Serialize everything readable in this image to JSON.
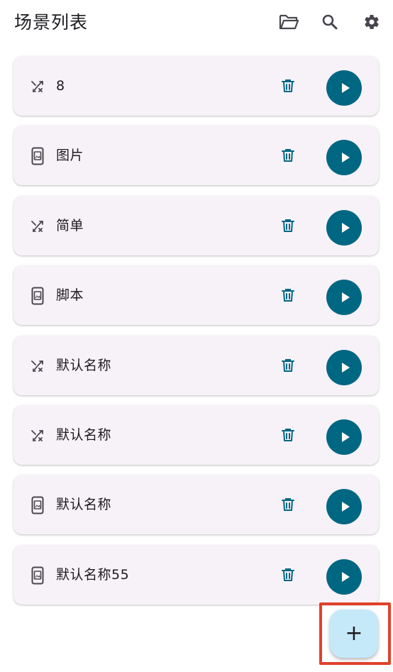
{
  "appbar": {
    "title": "场景列表",
    "actions": [
      {
        "name": "folder-open-icon"
      },
      {
        "name": "search-icon"
      },
      {
        "name": "settings-gear-icon"
      }
    ]
  },
  "scenes": [
    {
      "name": "8",
      "type_icon": "shuffle-cross-icon"
    },
    {
      "name": "图片",
      "type_icon": "phone-screenshot-icon"
    },
    {
      "name": "简单",
      "type_icon": "shuffle-cross-icon"
    },
    {
      "name": "脚本",
      "type_icon": "phone-screenshot-icon"
    },
    {
      "name": "默认名称",
      "type_icon": "shuffle-cross-icon"
    },
    {
      "name": "默认名称",
      "type_icon": "shuffle-cross-icon"
    },
    {
      "name": "默认名称",
      "type_icon": "phone-screenshot-icon"
    },
    {
      "name": "默认名称55",
      "type_icon": "phone-screenshot-icon"
    }
  ],
  "fab": {
    "label": "+"
  },
  "colors": {
    "accent": "#006783",
    "card_bg": "#f7f2f8",
    "fab_bg": "#c6e9fa",
    "highlight_frame": "#e0412a"
  }
}
